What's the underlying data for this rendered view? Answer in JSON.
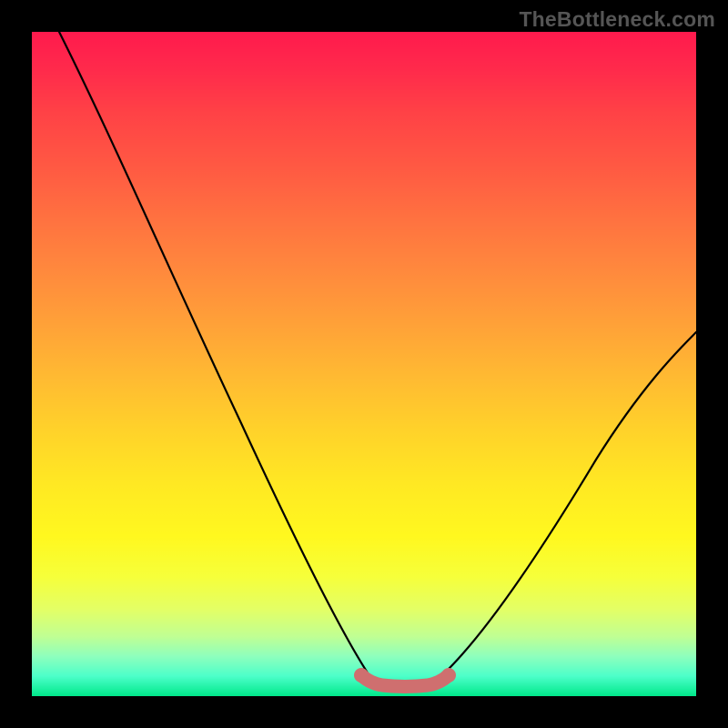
{
  "watermark": "TheBottleneck.com",
  "chart_data": {
    "type": "line",
    "title": "",
    "xlabel": "",
    "ylabel": "",
    "xlim": [
      0,
      100
    ],
    "ylim": [
      0,
      100
    ],
    "grid": false,
    "legend": false,
    "background_gradient": {
      "top": "#ff1a4d",
      "middle": "#ffe823",
      "bottom": "#00e88a"
    },
    "annotations": [
      {
        "text": "TheBottleneck.com",
        "position": "top-right",
        "color": "#555"
      }
    ],
    "series": [
      {
        "name": "left-curve",
        "color": "#000000",
        "x": [
          4,
          8,
          12,
          16,
          20,
          24,
          28,
          32,
          36,
          40,
          44,
          48,
          50,
          52
        ],
        "y": [
          100,
          92,
          84,
          76,
          68,
          60,
          52,
          44,
          36,
          28,
          20,
          10,
          5,
          2
        ]
      },
      {
        "name": "right-curve",
        "color": "#000000",
        "x": [
          62,
          64,
          68,
          72,
          76,
          80,
          84,
          88,
          92,
          96,
          100
        ],
        "y": [
          2,
          4,
          9,
          15,
          21,
          27,
          33,
          39,
          45,
          50,
          55
        ]
      },
      {
        "name": "valley-floor",
        "color": "#cf6f6f",
        "stroke_width": 14,
        "x": [
          50,
          52,
          54,
          56,
          58,
          60,
          62
        ],
        "y": [
          2.4,
          1.6,
          1.3,
          1.2,
          1.3,
          1.6,
          2.4
        ]
      }
    ]
  }
}
